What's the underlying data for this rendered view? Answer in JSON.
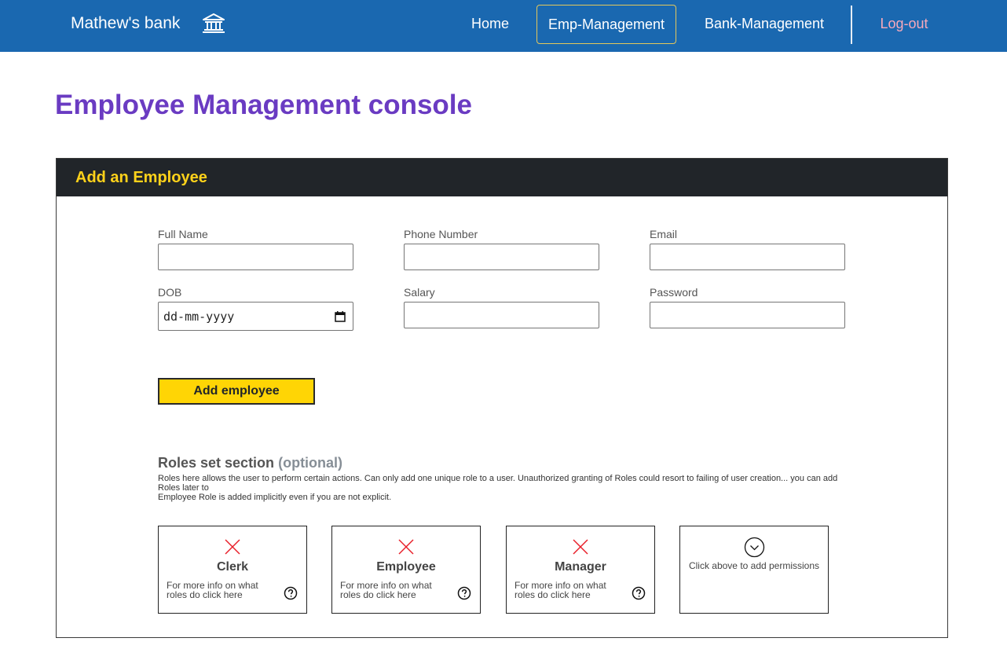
{
  "navbar": {
    "brand": "Mathew's bank",
    "brand_icon": "bank-icon",
    "links": [
      "Home",
      "Emp-Management",
      "Bank-Management"
    ],
    "logout": "Log-out"
  },
  "page": {
    "title": "Employee Management console"
  },
  "card": {
    "title": "Add an Employee",
    "fields": {
      "full_name": {
        "label": "Full Name",
        "value": ""
      },
      "phone": {
        "label": "Phone Number",
        "value": ""
      },
      "email": {
        "label": "Email",
        "value": ""
      },
      "dob": {
        "label": "DOB",
        "placeholder": "dd-mm-yyyy"
      },
      "salary": {
        "label": "Salary",
        "value": ""
      },
      "password": {
        "label": "Password",
        "value": ""
      }
    },
    "add_button": "Add employee"
  },
  "roles": {
    "title": "Roles set section",
    "optional": "(optional)",
    "desc_line1": "Roles here allows the user to perform certain actions. Can only add one unique role to a user. Unauthorized granting of Roles could resort to failing of user creation... you can add Roles later to",
    "desc_line2": "Employee Role is added implicitly even if you are not explicit.",
    "cards": [
      {
        "name": "Clerk",
        "info": "For more info on what roles do click here"
      },
      {
        "name": "Employee",
        "info": "For more info on what roles do click here"
      },
      {
        "name": "Manager",
        "info": "For more info on what roles do click here"
      }
    ],
    "add_permissions": "Click above to add permissions"
  },
  "colors": {
    "navbar": "#1a68b0",
    "title": "#6a3bc2",
    "card_header": "#212529",
    "card_title": "#ffd21a",
    "button": "#ffd505",
    "logout": "#f7a9bb",
    "x_icon": "#e8202a"
  }
}
